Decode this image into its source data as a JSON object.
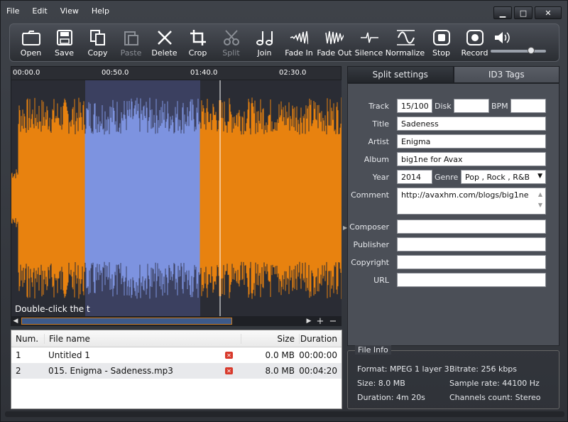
{
  "menu": [
    "File",
    "Edit",
    "View",
    "Help"
  ],
  "window_buttons": {
    "minimize": "▁",
    "maximize": "□",
    "close": "✕"
  },
  "toolbar": [
    {
      "label": "Open",
      "icon": "folder-icon",
      "enabled": true
    },
    {
      "label": "Save",
      "icon": "floppy-icon",
      "enabled": true
    },
    {
      "label": "Copy",
      "icon": "copy-icon",
      "enabled": true
    },
    {
      "label": "Paste",
      "icon": "paste-icon",
      "enabled": false
    },
    {
      "label": "Delete",
      "icon": "scissors-x-icon",
      "enabled": true
    },
    {
      "label": "Crop",
      "icon": "crop-icon",
      "enabled": true
    },
    {
      "label": "Split",
      "icon": "scissors-icon",
      "enabled": false
    },
    {
      "label": "Join",
      "icon": "notes-icon",
      "enabled": true
    },
    {
      "label": "Fade In",
      "icon": "fade-in-icon",
      "enabled": true
    },
    {
      "label": "Fade Out",
      "icon": "fade-out-icon",
      "enabled": true
    },
    {
      "label": "Silence",
      "icon": "silence-icon",
      "enabled": true
    },
    {
      "label": "Normalize",
      "icon": "normalize-icon",
      "enabled": true
    },
    {
      "label": "Stop",
      "icon": "stop-icon",
      "enabled": true
    },
    {
      "label": "Record",
      "icon": "record-icon",
      "enabled": true
    }
  ],
  "volume": {
    "icon": "speaker-icon",
    "level": 0.75
  },
  "timeline": [
    "00:00.0",
    "00:50.0",
    "01:40.0",
    "02:30.0"
  ],
  "waveform": {
    "hint": "Double-click the t",
    "colors": {
      "wave": "#e8820f",
      "selection": "#7d93e0",
      "background": "#2a2c34"
    }
  },
  "filelist": {
    "headers": {
      "num": "Num.",
      "name": "File name",
      "size": "Size",
      "duration": "Duration"
    },
    "rows": [
      {
        "num": "1",
        "name": "Untitled 1",
        "size": "0.0 MB",
        "duration": "00:00:00"
      },
      {
        "num": "2",
        "name": "015. Enigma - Sadeness.mp3",
        "size": "8.0 MB",
        "duration": "00:04:20"
      }
    ]
  },
  "tabs": {
    "split": "Split settings",
    "id3": "ID3 Tags"
  },
  "id3": {
    "track_label": "Track",
    "track": "15/100",
    "disk_label": "Disk",
    "disk": "",
    "bpm_label": "BPM",
    "bpm": "",
    "title_label": "Title",
    "title": "Sadeness",
    "artist_label": "Artist",
    "artist": "Enigma",
    "album_label": "Album",
    "album": "big1ne for Avax",
    "year_label": "Year",
    "year": "2014",
    "genre_label": "Genre",
    "genre": "Pop , Rock , R&B",
    "comment_label": "Comment",
    "comment": "http://avaxhm.com/blogs/big1ne",
    "composer_label": "Composer",
    "composer": "",
    "publisher_label": "Publisher",
    "publisher": "",
    "copyright_label": "Copyright",
    "copyright": "",
    "url_label": "URL",
    "url": ""
  },
  "fileinfo": {
    "title": "File Info",
    "format": "Format: MPEG 1 layer 3",
    "bitrate": "Bitrate: 256 kbps",
    "size": "Size: 8.0 MB",
    "samplerate": "Sample rate: 44100 Hz",
    "duration": "Duration: 4m 20s",
    "channels": "Channels count: Stereo"
  }
}
